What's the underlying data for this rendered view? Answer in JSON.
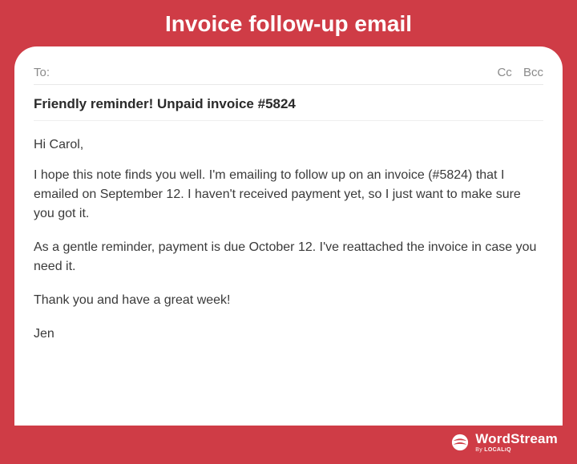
{
  "title": "Invoice follow-up email",
  "header": {
    "to_label": "To:",
    "cc_label": "Cc",
    "bcc_label": "Bcc"
  },
  "subject": "Friendly reminder! Unpaid invoice #5824",
  "body": {
    "greeting": "Hi Carol,",
    "p1": "I hope this note finds you well. I'm emailing to follow up on an invoice (#5824) that I emailed on September 12. I haven't received  payment yet, so I just want to make sure you got it.",
    "p2": "As a gentle reminder, payment is due October 12. I've reattached the invoice in case you need it.",
    "p3": "Thank you and have a great week!",
    "signature": "Jen"
  },
  "brand": {
    "name": "WordStream",
    "byline_prefix": "By ",
    "byline_name": "LOCALiQ"
  }
}
